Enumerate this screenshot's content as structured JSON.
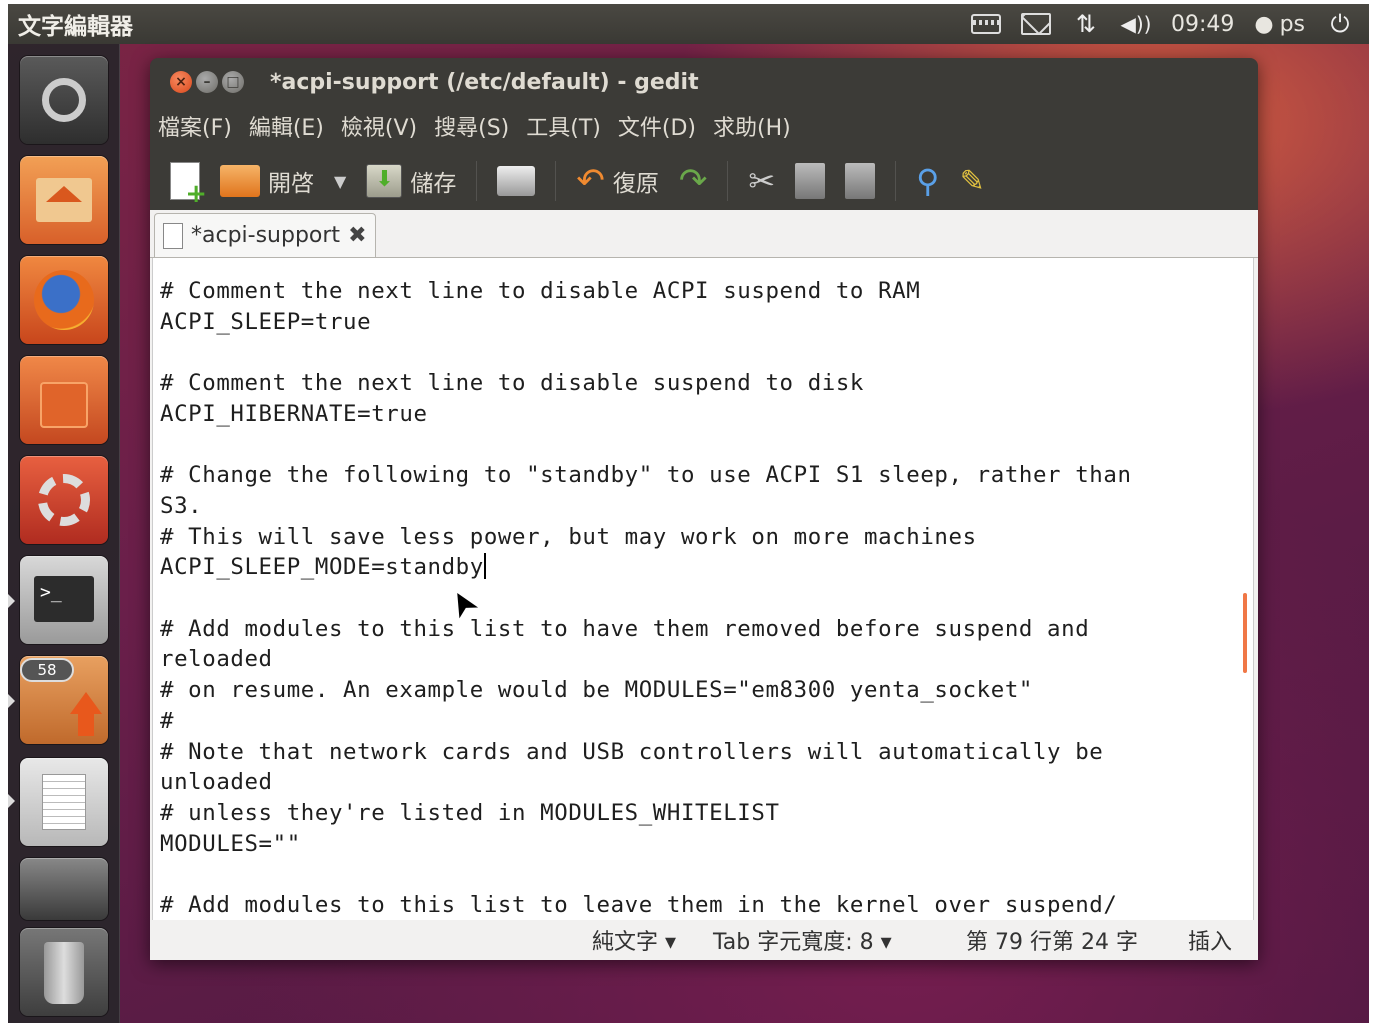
{
  "panel": {
    "app_title": "文字編輯器",
    "time": "09:49",
    "user": "ps",
    "icons": [
      "keyboard-icon",
      "mail-icon",
      "network-icon",
      "volume-icon",
      "user-icon",
      "power-icon"
    ]
  },
  "launcher": {
    "items": [
      {
        "name": "dash-home",
        "icon": "ubuntu-logo-icon"
      },
      {
        "name": "home-folder",
        "icon": "home-folder-icon"
      },
      {
        "name": "firefox",
        "icon": "firefox-icon"
      },
      {
        "name": "software-center",
        "icon": "shopping-bag-icon"
      },
      {
        "name": "system-settings",
        "icon": "gear-wrench-icon"
      },
      {
        "name": "terminal",
        "icon": "terminal-icon"
      },
      {
        "name": "update-manager",
        "icon": "update-arrow-icon"
      },
      {
        "name": "gedit",
        "icon": "text-editor-icon"
      },
      {
        "name": "workspace-switcher",
        "icon": "workspace-icon"
      },
      {
        "name": "trash",
        "icon": "trash-icon"
      }
    ],
    "update_badge": "58"
  },
  "window": {
    "title": "*acpi-support (/etc/default) - gedit",
    "menu": [
      "檔案(F)",
      "編輯(E)",
      "檢視(V)",
      "搜尋(S)",
      "工具(T)",
      "文件(D)",
      "求助(H)"
    ],
    "toolbar": {
      "open_label": "開啓",
      "save_label": "儲存",
      "undo_label": "復原"
    },
    "tab_label": "*acpi-support",
    "lines": [
      "# Comment the next line to disable ACPI suspend to RAM",
      "ACPI_SLEEP=true",
      "",
      "# Comment the next line to disable suspend to disk",
      "ACPI_HIBERNATE=true",
      "",
      "# Change the following to \"standby\" to use ACPI S1 sleep, rather than",
      "S3.",
      "# This will save less power, but may work on more machines",
      "ACPI_SLEEP_MODE=standby",
      "",
      "# Add modules to this list to have them removed before suspend and",
      "reloaded",
      "# on resume. An example would be MODULES=\"em8300 yenta_socket\"",
      "#",
      "# Note that network cards and USB controllers will automatically be",
      "unloaded",
      "# unless they're listed in MODULES_WHITELIST",
      "MODULES=\"\"",
      "",
      "# Add modules to this list to leave them in the kernel over suspend/"
    ],
    "status": {
      "language": "純文字 ▾",
      "tab_width": "Tab 字元寬度: 8 ▾",
      "position": "第 79 行第 24 字",
      "mode": "插入"
    }
  },
  "colors": {
    "panel": "#3c3b37",
    "accent": "#f07746",
    "close_button": "#e0521e"
  }
}
